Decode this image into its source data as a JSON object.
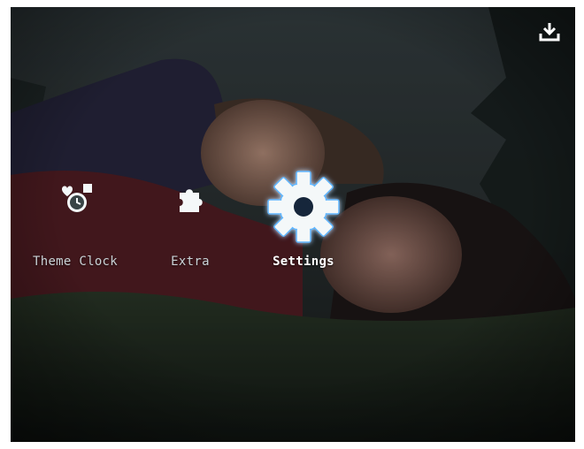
{
  "menu": {
    "items": [
      {
        "label": "Theme Clock",
        "icon": "theme-clock-icon",
        "state": "normal"
      },
      {
        "label": "Extra",
        "icon": "puzzle-icon",
        "state": "normal"
      },
      {
        "label": "Settings",
        "icon": "gear-icon",
        "state": "selected"
      }
    ]
  },
  "toolbar": {
    "download_icon": "download-icon"
  },
  "colors": {
    "accent_glow": "#5fb6ff",
    "icon_white": "#f4f8f9"
  }
}
